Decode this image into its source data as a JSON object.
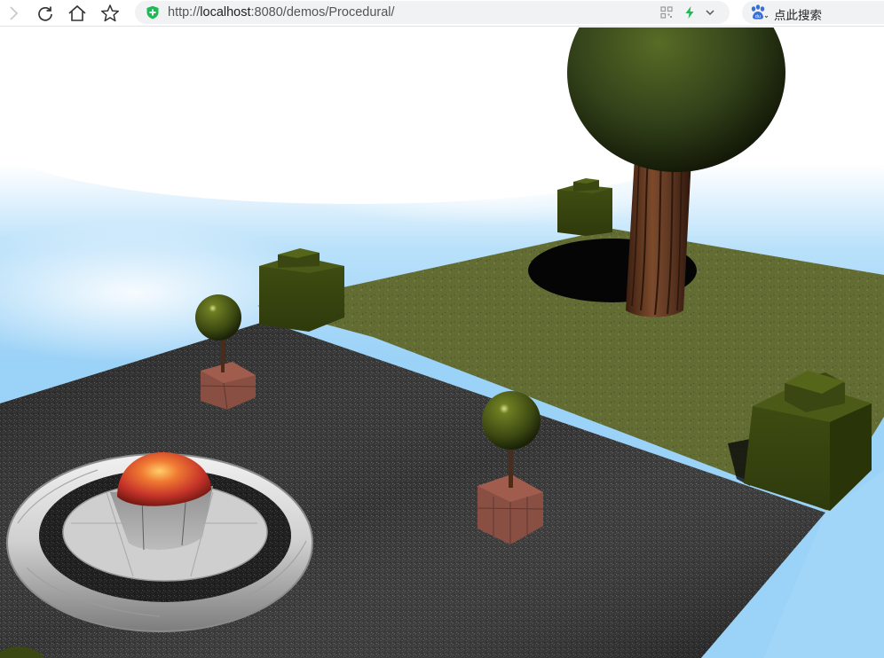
{
  "browser": {
    "url_prefix": "http://",
    "url_host": "localhost",
    "url_path": ":8080/demos/Procedural/",
    "search_placeholder": "点此搜索",
    "icons": {
      "forward": "chevron-right-icon",
      "reload": "reload-icon",
      "home": "home-icon",
      "bookmark": "star-icon",
      "security": "shield-icon",
      "qr": "qr-code-icon",
      "speed": "lightning-icon",
      "dropdown": "chevron-down-icon",
      "search_engine": "baidu-paw-icon"
    }
  },
  "scene": {
    "description_colors": {
      "sky_blue": "#9ed3f5",
      "grass": "#6e7a3a",
      "asphalt": "#2a2a2a",
      "hedge": "#3d4a10",
      "tree_canopy": "#394a17",
      "trunk": "#5a3420",
      "brick": "#8a4f43",
      "marble": "#d9d9d9",
      "fire_ball": "#d8452a"
    }
  }
}
